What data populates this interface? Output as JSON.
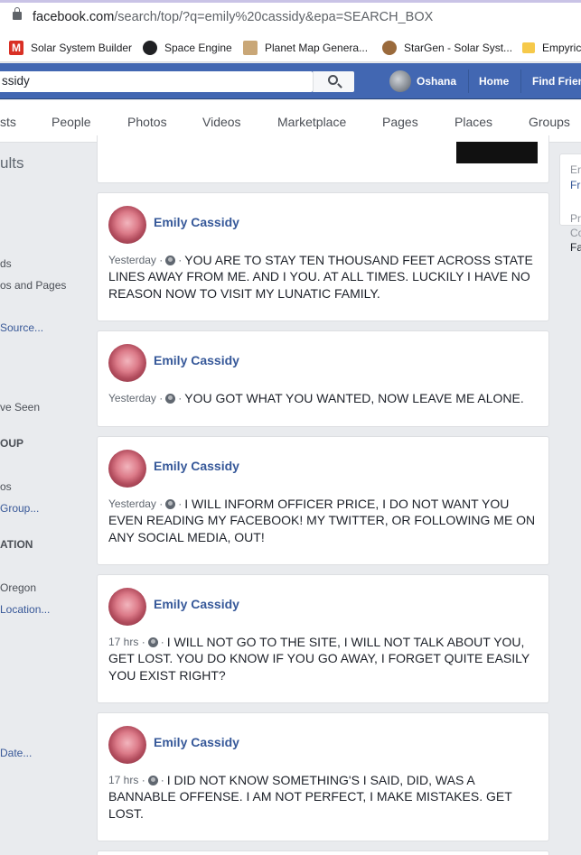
{
  "browser": {
    "url_host": "facebook.com",
    "url_path": "/search/top/?q=emily%20cassidy&epa=SEARCH_BOX"
  },
  "bookmarks": [
    {
      "label": "Solar System Builder",
      "icon": "m-logo-icon",
      "color": "#d93025"
    },
    {
      "label": "Space Engine",
      "icon": "engine-icon",
      "color": "#202124"
    },
    {
      "label": "Planet Map Genera...",
      "icon": "planet-icon",
      "color": "#a67c52"
    },
    {
      "label": "StarGen - Solar Syst...",
      "icon": "stargen-icon",
      "color": "#7b4b2a"
    },
    {
      "label": "Empyric",
      "icon": "folder-icon",
      "color": "#f6c94a"
    }
  ],
  "header": {
    "search_value": "ssidy",
    "user_name": "Oshana",
    "home_label": "Home",
    "find_friends_label": "Find Frien"
  },
  "tabs": [
    "sts",
    "People",
    "Photos",
    "Videos",
    "Marketplace",
    "Pages",
    "Places",
    "Groups"
  ],
  "left_filters": {
    "results_heading": "ults",
    "items": [
      {
        "text": "ds",
        "style": "plain"
      },
      {
        "text": "os and Pages",
        "style": "plain"
      },
      {
        "text": "Source...",
        "style": "link"
      },
      {
        "text": "ve Seen",
        "style": "plain"
      },
      {
        "text": "OUP",
        "style": "head"
      },
      {
        "text": "os",
        "style": "plain"
      },
      {
        "text": "Group...",
        "style": "link"
      },
      {
        "text": "ATION",
        "style": "head"
      },
      {
        "text": "Oregon",
        "style": "plain"
      },
      {
        "text": "Location...",
        "style": "link"
      },
      {
        "text": "Date...",
        "style": "link"
      }
    ]
  },
  "right_column": {
    "card_lines": [
      "Er",
      "Fr"
    ],
    "lines": [
      "Pr",
      "Co",
      "Fa"
    ]
  },
  "posts": [
    {
      "author": "Emily Cassidy",
      "time": "Yesterday",
      "text": "YOU ARE TO STAY TEN THOUSAND FEET ACROSS STATE LINES AWAY FROM ME. AND I YOU. AT ALL TIMES. LUCKILY I HAVE NO REASON NOW TO VISIT MY LUNATIC FAMILY.",
      "first_line": "YOU ARE TO STAY TEN THOUSAND FEET ACROSS STATE",
      "rest": "LINES AWAY FROM ME. AND I YOU. AT ALL TIMES. LUCKILY I HAVE NO REASON NOW TO VISIT MY LUNATIC FAMILY."
    },
    {
      "author": "Emily Cassidy",
      "time": "Yesterday",
      "first_line": "YOU GOT WHAT YOU WANTED, NOW LEAVE ME ALONE.",
      "rest": ""
    },
    {
      "author": "Emily Cassidy",
      "time": "Yesterday",
      "first_line": "I WILL INFORM OFFICER PRICE, I DO NOT WANT YOU",
      "rest": "EVEN READING MY FACEBOOK! MY TWITTER, OR FOLLOWING ME ON ANY SOCIAL MEDIA, OUT!"
    },
    {
      "author": "Emily Cassidy",
      "time": "17 hrs",
      "first_line": "I WILL NOT GO TO THE SITE, I WILL NOT TALK ABOUT YOU,",
      "rest": "GET LOST. YOU DO KNOW IF YOU GO AWAY, I FORGET QUITE EASILY YOU EXIST RIGHT?"
    },
    {
      "author": "Emily Cassidy",
      "time": "17 hrs",
      "first_line": "I DID NOT KNOW SOMETHING'S I SAID, DID, WAS A",
      "rest": "BANNABLE OFFENSE. I AM NOT PERFECT, I MAKE MISTAKES. GET LOST."
    }
  ]
}
